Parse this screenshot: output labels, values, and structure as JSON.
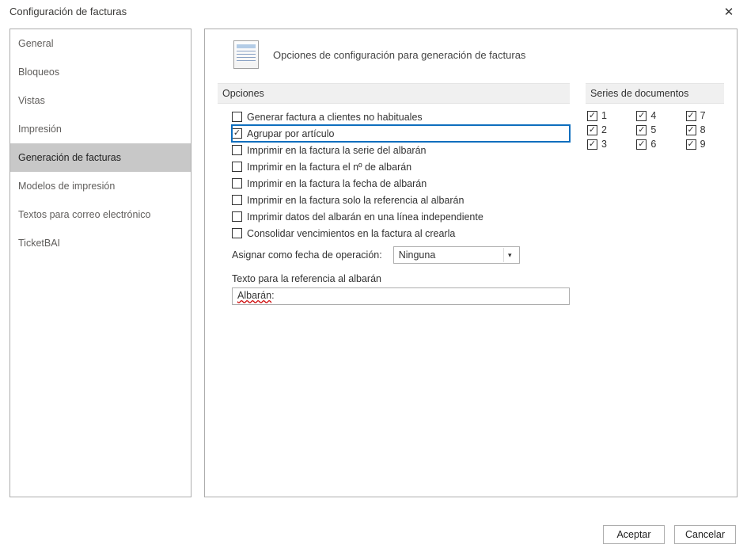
{
  "dialog": {
    "title": "Configuración de facturas"
  },
  "sidebar": {
    "items": [
      {
        "label": "General",
        "selected": false
      },
      {
        "label": "Bloqueos",
        "selected": false
      },
      {
        "label": "Vistas",
        "selected": false
      },
      {
        "label": "Impresión",
        "selected": false
      },
      {
        "label": "Generación de facturas",
        "selected": true
      },
      {
        "label": "Modelos de impresión",
        "selected": false
      },
      {
        "label": "Textos para correo electrónico",
        "selected": false
      },
      {
        "label": "TicketBAI",
        "selected": false
      }
    ]
  },
  "page": {
    "heading": "Opciones de configuración para generación de facturas",
    "options_header": "Opciones",
    "series_header": "Series de documentos",
    "options": [
      {
        "label": "Generar factura a clientes no habituales",
        "checked": false,
        "highlighted": false
      },
      {
        "label": "Agrupar por artículo",
        "checked": true,
        "highlighted": true
      },
      {
        "label": "Imprimir en la factura la serie del albarán",
        "checked": false,
        "highlighted": false
      },
      {
        "label": "Imprimir en la factura el nº de albarán",
        "checked": false,
        "highlighted": false
      },
      {
        "label": "Imprimir en la factura la fecha de albarán",
        "checked": false,
        "highlighted": false
      },
      {
        "label": "Imprimir en la factura solo la referencia al albarán",
        "checked": false,
        "highlighted": false
      },
      {
        "label": "Imprimir datos del albarán en una línea independiente",
        "checked": false,
        "highlighted": false
      },
      {
        "label": "Consolidar vencimientos en la factura al crearla",
        "checked": false,
        "highlighted": false
      }
    ],
    "assign_label": "Asignar como fecha de operación:",
    "assign_value": "Ninguna",
    "ref_label": "Texto para la referencia al albarán",
    "ref_value": "Albarán:",
    "series": [
      {
        "label": "1",
        "checked": true
      },
      {
        "label": "4",
        "checked": true
      },
      {
        "label": "7",
        "checked": true
      },
      {
        "label": "2",
        "checked": true
      },
      {
        "label": "5",
        "checked": true
      },
      {
        "label": "8",
        "checked": true
      },
      {
        "label": "3",
        "checked": true
      },
      {
        "label": "6",
        "checked": true
      },
      {
        "label": "9",
        "checked": true
      }
    ]
  },
  "buttons": {
    "accept": "Aceptar",
    "cancel": "Cancelar"
  }
}
